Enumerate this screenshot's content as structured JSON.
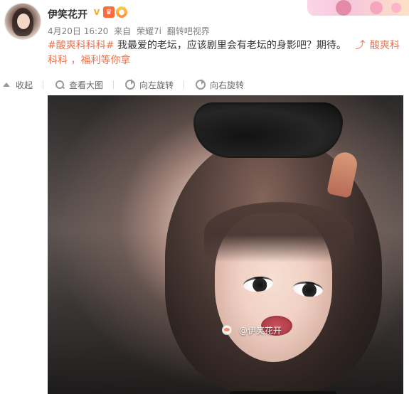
{
  "post": {
    "username": "伊笑花开",
    "meta": {
      "time": "4月20日 16:20",
      "source_prefix": "来自",
      "device": "荣耀7i",
      "extra": "翻转吧视界"
    },
    "content": {
      "hashtag": "#酸爽科科科#",
      "text": "我最爱的老坛，应该剧里会有老坛的身影吧？期待。",
      "link_text": "酸爽科科科",
      "continuation": "，福利等你拿"
    }
  },
  "toolbar": {
    "collapse": "收起",
    "view_large": "查看大图",
    "rotate_left": "向左旋转",
    "rotate_right": "向右旋转"
  },
  "image": {
    "watermark_text": "@伊笑花开"
  },
  "icons": {
    "verified": "verified-badge-icon",
    "crown": "crown-badge-icon",
    "balloon": "balloon-badge-icon",
    "link": "link-icon",
    "collapse": "collapse-icon",
    "search": "search-icon",
    "rotate_left": "rotate-left-icon",
    "rotate_right": "rotate-right-icon",
    "weibo": "weibo-icon"
  },
  "colors": {
    "accent": "#eb7350",
    "text": "#333333",
    "muted": "#808080"
  }
}
